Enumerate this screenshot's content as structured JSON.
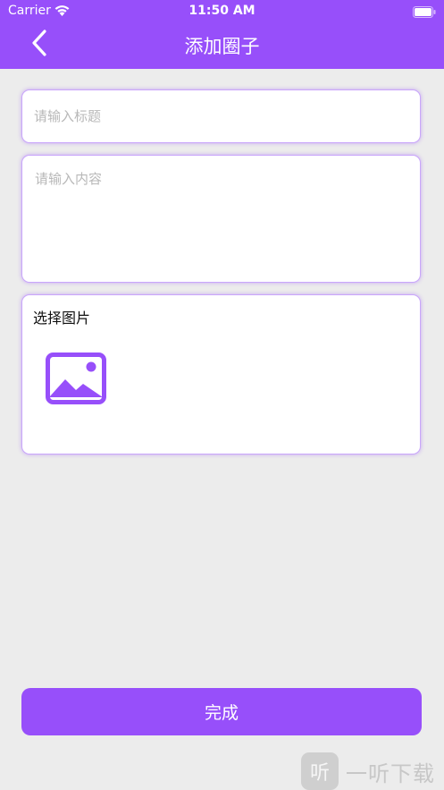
{
  "status_bar": {
    "carrier": "Carrier",
    "time": "11:50 AM",
    "wifi_icon": "wifi-icon",
    "battery_icon": "battery-icon"
  },
  "nav": {
    "title": "添加圈子",
    "back_icon": "chevron-left-icon"
  },
  "form": {
    "title_placeholder": "请输入标题",
    "title_value": "",
    "content_placeholder": "请输入内容",
    "content_value": "",
    "image_label": "选择图片",
    "image_icon": "image-placeholder-icon"
  },
  "actions": {
    "done_label": "完成"
  },
  "watermark": {
    "logo_text": "听",
    "text": "一听下载"
  },
  "colors": {
    "accent": "#974ffa",
    "background": "#ececec",
    "card_border": "#c9a6fb",
    "placeholder": "#b8b8b8"
  }
}
